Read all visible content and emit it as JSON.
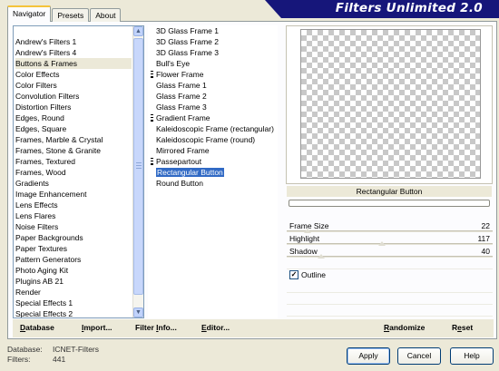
{
  "app": {
    "title": "Filters Unlimited 2.0"
  },
  "tabs": [
    {
      "label": "Navigator",
      "active": true
    },
    {
      "label": "Presets",
      "active": false
    },
    {
      "label": "About",
      "active": false
    }
  ],
  "categories": {
    "items": [
      "Andrew's Filters 1",
      "Andrew's Filters 4",
      "Buttons & Frames",
      "Color Effects",
      "Color Filters",
      "Convolution Filters",
      "Distortion Filters",
      "Edges, Round",
      "Edges, Square",
      "Frames, Marble & Crystal",
      "Frames, Stone & Granite",
      "Frames, Textured",
      "Frames, Wood",
      "Gradients",
      "Image Enhancement",
      "Lens Effects",
      "Lens Flares",
      "Noise Filters",
      "Paper Backgrounds",
      "Paper Textures",
      "Pattern Generators",
      "Photo Aging Kit",
      "Plugins AB 21",
      "Render",
      "Special Effects 1",
      "Special Effects 2"
    ],
    "selected": "Buttons & Frames",
    "scroll_up_glyph": "▲",
    "scroll_down_glyph": "▼"
  },
  "filters": {
    "items": [
      {
        "label": "3D Glass Frame 1",
        "group": false
      },
      {
        "label": "3D Glass Frame 2",
        "group": false
      },
      {
        "label": "3D Glass Frame 3",
        "group": false
      },
      {
        "label": "Bull's Eye",
        "group": false
      },
      {
        "label": "Flower Frame",
        "group": true
      },
      {
        "label": "Glass Frame 1",
        "group": false
      },
      {
        "label": "Glass Frame 2",
        "group": false
      },
      {
        "label": "Glass Frame 3",
        "group": false
      },
      {
        "label": "Gradient Frame",
        "group": true
      },
      {
        "label": "Kaleidoscopic Frame (rectangular)",
        "group": false
      },
      {
        "label": "Kaleidoscopic Frame (round)",
        "group": false
      },
      {
        "label": "Mirrored Frame",
        "group": false
      },
      {
        "label": "Passepartout",
        "group": true
      },
      {
        "label": "Rectangular Button",
        "group": false
      },
      {
        "label": "Round Button",
        "group": false
      }
    ],
    "selected": "Rectangular Button"
  },
  "preview": {
    "caption": "Rectangular Button",
    "progress": 0
  },
  "controls": [
    {
      "label": "Frame Size",
      "value": "22",
      "level": 0.086
    },
    {
      "label": "Highlight",
      "value": "117",
      "level": 0.459
    },
    {
      "label": "Shadow",
      "value": "40",
      "level": 0.157
    }
  ],
  "outline": {
    "label": "Outline",
    "checked": true,
    "check_glyph": "✓"
  },
  "link_buttons": {
    "database": {
      "prefix": "",
      "underline": "D",
      "rest": "atabase"
    },
    "import": {
      "prefix": "",
      "underline": "I",
      "rest": "mport..."
    },
    "filter_info": {
      "prefix": "Filter ",
      "underline": "I",
      "rest": "nfo..."
    },
    "editor": {
      "prefix": "",
      "underline": "E",
      "rest": "ditor..."
    },
    "randomize": {
      "prefix": "",
      "underline": "R",
      "rest": "andomize"
    },
    "reset": {
      "prefix": "R",
      "underline": "e",
      "rest": "set"
    }
  },
  "footer": {
    "database_label": "Database:",
    "database_value": "ICNET-Filters",
    "filters_label": "Filters:",
    "filters_value": "441"
  },
  "buttons": {
    "apply": "Apply",
    "cancel": "Cancel",
    "help": "Help"
  },
  "colors": {
    "banner": "#16167a",
    "selection": "#316ac5",
    "tab_highlight": "#f4c33a"
  }
}
